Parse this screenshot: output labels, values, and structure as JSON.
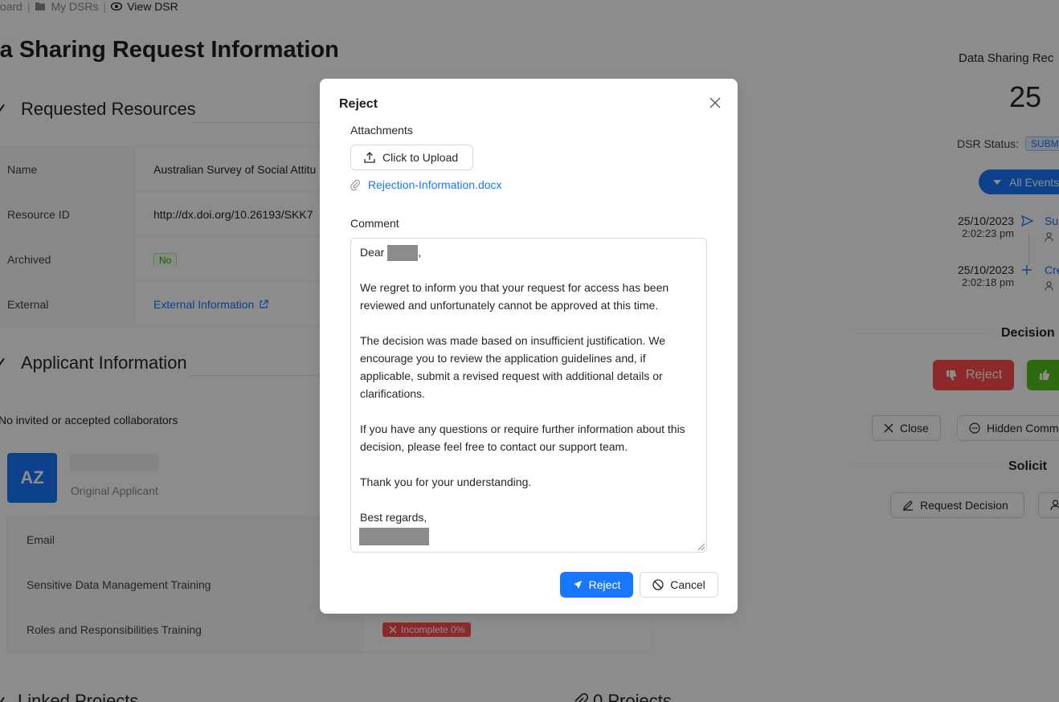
{
  "breadcrumb": {
    "item1": "board",
    "item2": "My DSRs",
    "item3": "View DSR"
  },
  "page": {
    "title": "ta Sharing Request Information"
  },
  "requested_resources": {
    "heading": "Requested Resources",
    "rows": [
      {
        "key": "Name",
        "value": "Australian Survey of Social Attitu"
      },
      {
        "key": "Resource ID",
        "value": "http://dx.doi.org/10.26193/SKK7"
      },
      {
        "key": "Archived",
        "value": "No"
      },
      {
        "key": "External",
        "value": "External Information"
      }
    ]
  },
  "applicant": {
    "heading": "Applicant Information",
    "collab_note": "No invited or accepted collaborators",
    "avatar_initials": "AZ",
    "role": "Original Applicant",
    "rows": [
      {
        "key": "Email",
        "value": ""
      },
      {
        "key": "Sensitive Data Management Training",
        "value": ""
      },
      {
        "key": "Roles and Responsibilities Training",
        "value": "Incomplete 0%"
      }
    ]
  },
  "bottom": {
    "linked_projects": "Linked Projects",
    "projects": "0 Projects"
  },
  "right_panel": {
    "title": "Data Sharing Rec",
    "count": "25",
    "status_label": "DSR Status:",
    "status_value": "SUBMI",
    "all_events": "All Events",
    "events": [
      {
        "date": "25/10/2023",
        "time": "2:02:23 pm",
        "label": "Su"
      },
      {
        "date": "25/10/2023",
        "time": "2:02:18 pm",
        "label": "Cre"
      }
    ],
    "decision_heading": "Decision",
    "reject_label": "Reject",
    "close_label": "Close",
    "hidden_comments_label": "Hidden Comm",
    "solicit_heading": "Solicit",
    "request_decision_label": "Request Decision"
  },
  "modal": {
    "title": "Reject",
    "attachments_label": "Attachments",
    "upload_label": "Click to Upload",
    "file_name": "Rejection-Information.docx",
    "comment_label": "Comment",
    "comment": {
      "greeting": "Dear",
      "p1": "We regret to inform you that your request for access has been reviewed and unfortunately cannot be approved at this time.",
      "p2": "The decision was made based on insufficient justification. We encourage you to review the application guidelines and, if applicable, submit a revised request with additional details or clarifications.",
      "p3": "If you have any questions or require further information about this decision, please feel free to contact our support team.",
      "p4": "Thank you for your understanding.",
      "closing": "Best regards,"
    },
    "reject_button": "Reject",
    "cancel_button": "Cancel"
  },
  "colors": {
    "primary": "#1677ff",
    "danger": "#ff4d4f",
    "success": "#52c41a"
  }
}
